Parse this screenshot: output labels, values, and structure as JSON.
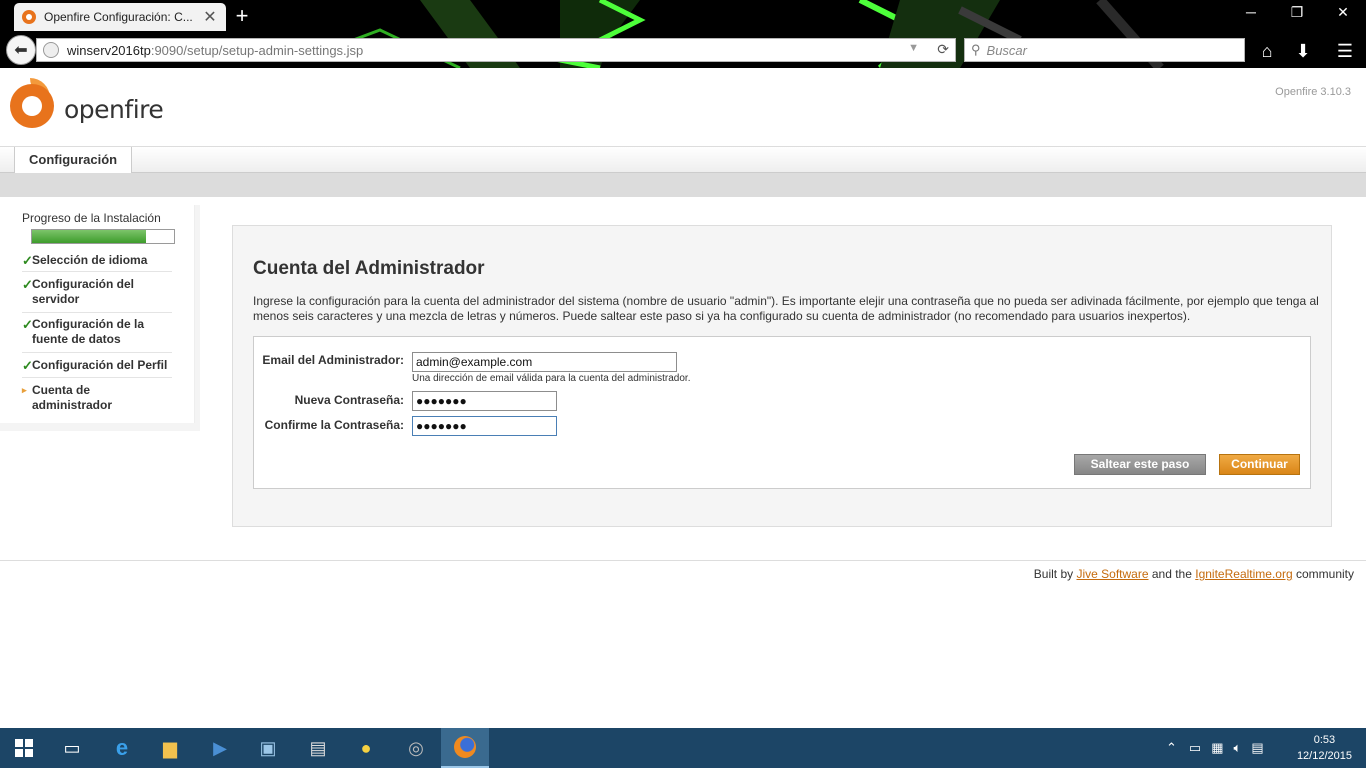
{
  "browser": {
    "tab_title": "Openfire Configuración: C...",
    "tab_close": "✕",
    "new_tab": "+",
    "url_host": "winserv2016tp",
    "url_rest": ":9090/setup/setup-admin-settings.jsp",
    "search_placeholder": "Buscar",
    "win_minimize": "─",
    "win_restore": "❐",
    "win_close": "✕"
  },
  "header": {
    "logo_text": "openfire",
    "version": "Openfire 3.10.3"
  },
  "tabs": {
    "main": "Configuración"
  },
  "sidebar": {
    "progress_label": "Progreso de la Instalación",
    "progress_value": 0.8,
    "steps": [
      {
        "label": "Selección de idioma",
        "mark": "✓"
      },
      {
        "label": "Configuración del servidor",
        "mark": "✓"
      },
      {
        "label": "Configuración de la fuente de datos",
        "mark": "✓"
      },
      {
        "label": "Configuración del Perfil",
        "mark": "✓"
      },
      {
        "label": "Cuenta de administrador",
        "mark": "▸"
      }
    ]
  },
  "content": {
    "title": "Cuenta del Administrador",
    "description": "Ingrese la configuración para la cuenta del administrador del sistema (nombre de usuario \"admin\"). Es importante elejir una contraseña que no pueda ser adivinada fácilmente, por ejemplo que tenga al menos seis caracteres y una mezcla de letras y números. Puede saltear este paso si ya ha configurado su cuenta de administrador (no recomendado para usuarios inexpertos).",
    "email_label": "Email del Administrador:",
    "email_value": "admin@example.com",
    "email_help": "Una dirección de email válida para la cuenta del administrador.",
    "password_label": "Nueva Contraseña:",
    "password_value": "●●●●●●●",
    "confirm_label": "Confirme la Contraseña:",
    "confirm_value": "●●●●●●●",
    "skip_button": "Saltear este paso",
    "continue_button": "Continuar"
  },
  "footer": {
    "prefix": "Built by",
    "link1": "Jive Software",
    "middle": "and the",
    "link2": "IgniteRealtime.org",
    "suffix": "community"
  },
  "taskbar": {
    "time": "0:53",
    "date": "12/12/2015"
  }
}
